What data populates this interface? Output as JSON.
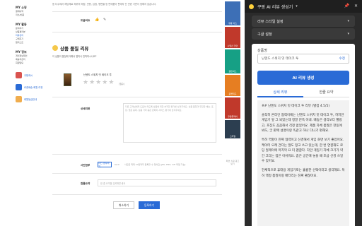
{
  "left_nav": {
    "groups": [
      {
        "title": "MY 쇼핑",
        "links": [
          "결제내역",
          "취소/반품"
        ]
      },
      {
        "title": "MY 활동",
        "links": [
          "문의하기",
          "상품평리뷰",
          "리뷰관리",
          "구매후기",
          "찜리스트"
        ]
      },
      {
        "title": "MY 정보",
        "links": [
          "개인정보확인",
          "배송지관리",
          "회원탈퇴"
        ]
      }
    ],
    "active_link": "리뷰관리",
    "cards": [
      {
        "label": "쿠팡캐시",
        "color": "#d9534f",
        "icon": "cash-icon"
      },
      {
        "label": "로켓배송 회원 리뷰",
        "color": "#2a6bd6",
        "icon": "rocket-icon"
      },
      {
        "label": "회원등급안내",
        "color": "#f0ad4e",
        "icon": "grade-icon"
      }
    ]
  },
  "content": {
    "notice": "동 다수에서 해당제로 하위의 매장, 관용, 입점, 평면을 등 판매품이 판매자 단 관련 기준이 정해지 않습니다.",
    "helpful_label": "도움되요",
    "review_section_title": "상품 품질 리뷰",
    "review_section_sub": "이 상품의 품질에 대해서 얼마나 만족하시나요?",
    "product_name": "닌텐도 스위치 잇 테이크 투",
    "rating_note": "(필수)",
    "detail_label": "상세리뷰",
    "detail_placeholder": "다른 고객님에게 도움이 되도록 상품에 대한 솔직한 평가를 남겨주세요. 상품 품질과 무관한 배송, 포장, 질문 응대, 상품 가격 등은 판매자 서비스 평가에 남겨주세요.",
    "photo_label": "사진첨부",
    "photo_button": "사진 첨부하기",
    "photo_count": "0/10",
    "photo_note": "사진은 최대 10장까지 등록할 수 있어요 (JPG, PNG, GIF 파일 가능)",
    "summary_label": "한줄요약",
    "summary_placeholder": "한 줄 요약을 입력해주세요",
    "cancel_button": "취소하기",
    "submit_button": "등록하기"
  },
  "ads": {
    "items": [
      {
        "label": "쿠팡 이츠",
        "color": "#3d6fb6"
      },
      {
        "label": "수입산 할인",
        "color": "#c0392b"
      },
      {
        "label": "골든박스",
        "color": "#16a085"
      },
      {
        "label": "로켓직구",
        "color": "#e67e22"
      },
      {
        "label": "쿠팡플레이",
        "color": "#c0392b"
      },
      {
        "label": "스타일",
        "color": "#2c3e50"
      }
    ],
    "note": "패션 쇼핑 광고 보기"
  },
  "panel": {
    "title": "쿠팡 AI 리뷰 생성기",
    "style_select": "리뷰 스타일 설정",
    "length_select": "구글 설정",
    "product_label": "상품명",
    "product_value": "닌텐도 스위치 잇 테이크 투",
    "edit_label": "수정",
    "generate_button": "AI 리뷰 생성",
    "tabs": [
      "상세 리뷰",
      "한줄 요약"
    ],
    "active_tab": 0,
    "result_paragraphs": [
      "## 닌텐도 스위치 잇 테이크 투 리뷰 (별점 4.5/5)",
      "솔직히 온라인 협력이에는 닌텐도 스위치 잇 테이크 투, 하지만 게임기 앞 그 되었는데 정말 만족 이네. 배송은 생각보다 빨랐고, 포장도 꼼꼼해서 걱정 없었어요. 제품 자체 품질은 한동에 봐도, 굿 판매 설명이랑 똑같고 하나 다니기 편해요.",
      "특히 역할이 진짜 협력이고 신경해서 게임 화면 보기 좋았어요. 케이터 오래 건다는 많도 정고 쓰고 있는데, 한 번 연결해도 로딩 딜레이에 마지막 요 더 괜찮다. 다만 게임기 자체 크기가 약간 크다는 점은 아쉬워요. 좀은 공간에 놓을 때 조금 신경 쓰일 수 있어요.",
      "전체적으로 휴대용 게임기로는 훌륭한 선택이라고 생각해요. 특히 액정 품질이랑 배터리는 진짜 괜찮아요."
    ]
  }
}
